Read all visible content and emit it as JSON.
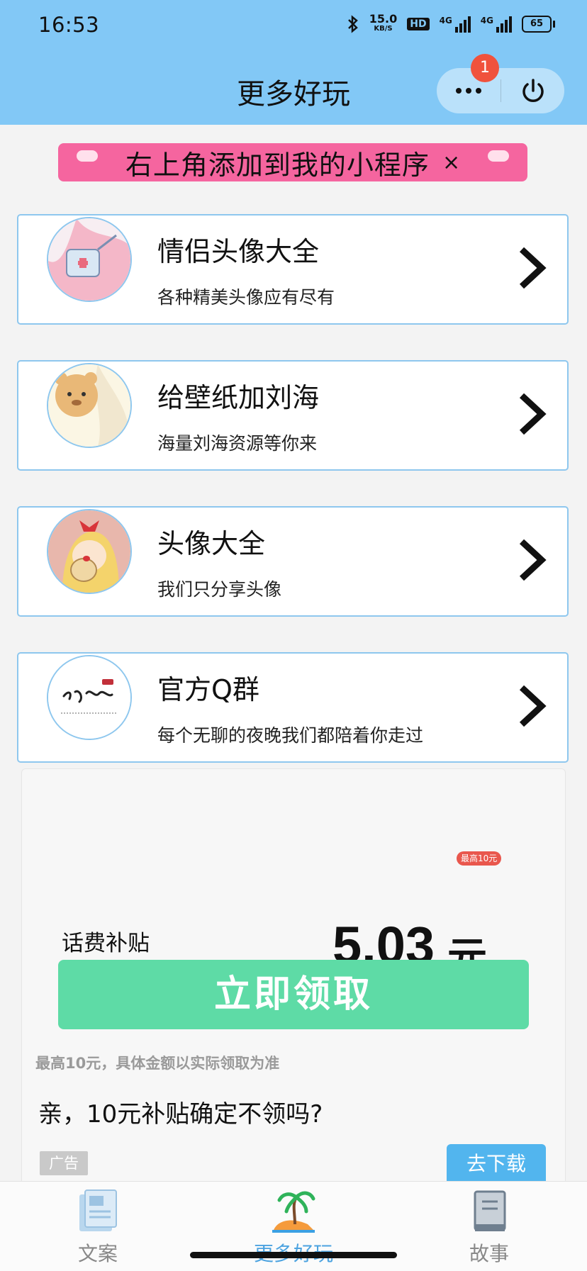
{
  "status_bar": {
    "time": "16:53",
    "net_speed_value": "15.0",
    "net_speed_unit": "KB/S",
    "hd_label": "HD",
    "network_1": "4G",
    "network_2": "4G",
    "battery": "65"
  },
  "header": {
    "title": "更多好玩",
    "notification_count": "1",
    "background_color": "#82c8f6"
  },
  "tip_banner": {
    "text": "右上角添加到我的小程序",
    "close_label": "×",
    "color": "#f5659f"
  },
  "cards": [
    {
      "title": "情侣头像大全",
      "subtitle": "各种精美头像应有尽有",
      "icon": "couple-avatar-thumbnail"
    },
    {
      "title": "给壁纸加刘海",
      "subtitle": "海量刘海资源等你来",
      "icon": "bear-wallpaper-thumbnail"
    },
    {
      "title": "头像大全",
      "subtitle": "我们只分享头像",
      "icon": "girl-avatar-thumbnail"
    },
    {
      "title": "官方Q群",
      "subtitle": "每个无聊的夜晚我们都陪着你走过",
      "icon": "calligraphy-logo-thumbnail"
    }
  ],
  "ad": {
    "label": "话费补贴",
    "amount": "5.03",
    "amount_unit": "元",
    "max_badge": "最高10元",
    "claim_button": "立即领取",
    "note": "最高10元，具体金额以实际领取为准",
    "question": "亲，10元补贴确定不领吗?",
    "ad_tag": "广告",
    "download_button": "去下载",
    "claim_color": "#5edba6",
    "download_color": "#52b5ee"
  },
  "tab_bar": {
    "tabs": [
      {
        "label": "文案",
        "icon": "copywriting-tab-icon",
        "active": false
      },
      {
        "label": "更多好玩",
        "icon": "island-tab-icon",
        "active": true
      },
      {
        "label": "故事",
        "icon": "book-tab-icon",
        "active": false
      }
    ],
    "active_color": "#4ca3e0"
  }
}
